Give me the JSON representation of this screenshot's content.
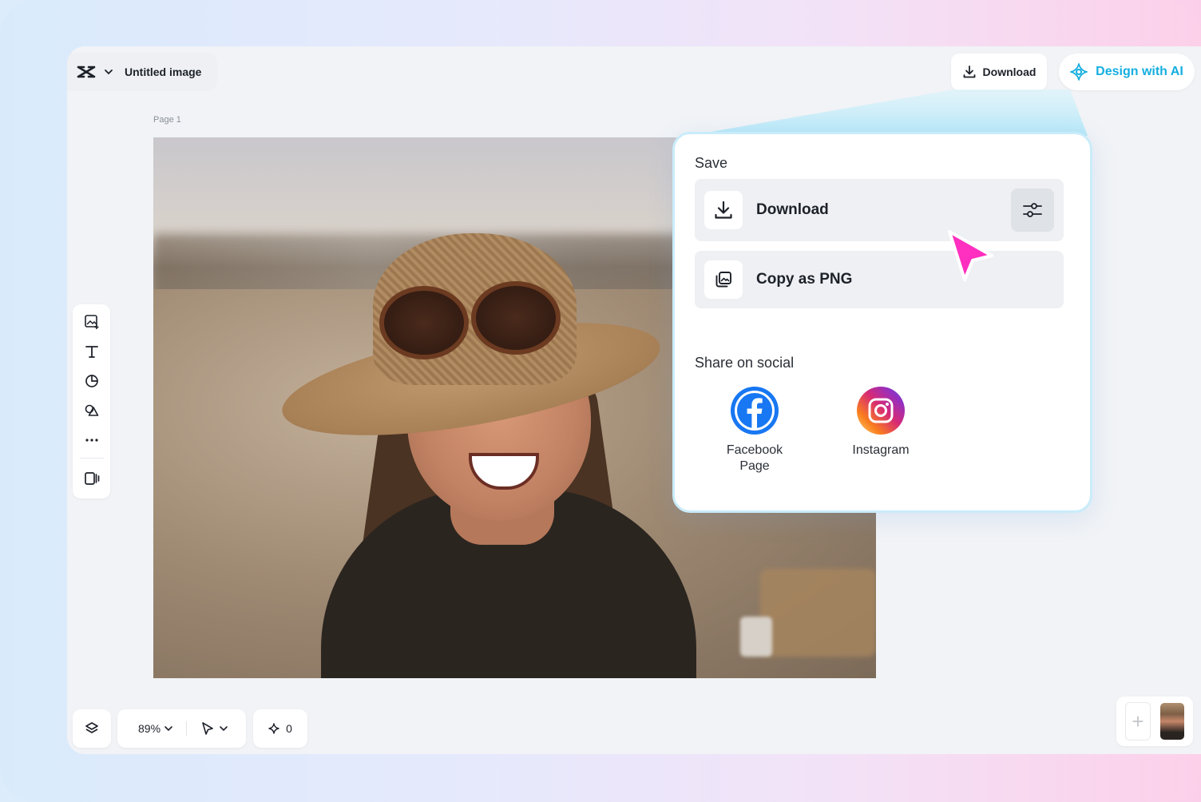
{
  "header": {
    "document_title": "Untitled image",
    "download_label": "Download",
    "design_ai_label": "Design with AI"
  },
  "canvas": {
    "page_label": "Page 1"
  },
  "toolbar": {
    "tools": [
      "add-image-icon",
      "text-icon",
      "shapes-icon",
      "elements-icon",
      "more-icon",
      "resize-icon"
    ]
  },
  "bottom_bar": {
    "zoom_label": "89%",
    "credits_count": "0"
  },
  "save_panel": {
    "save_heading": "Save",
    "download_label": "Download",
    "copy_png_label": "Copy as PNG",
    "share_heading": "Share on social",
    "social": [
      {
        "name": "Facebook Page",
        "color": "#1877f2"
      },
      {
        "name": "Instagram",
        "color": "#e1306c"
      }
    ]
  },
  "colors": {
    "accent": "#15aee0",
    "cursor": "#ff2fbf",
    "panel_border": "#c9ecfa"
  }
}
